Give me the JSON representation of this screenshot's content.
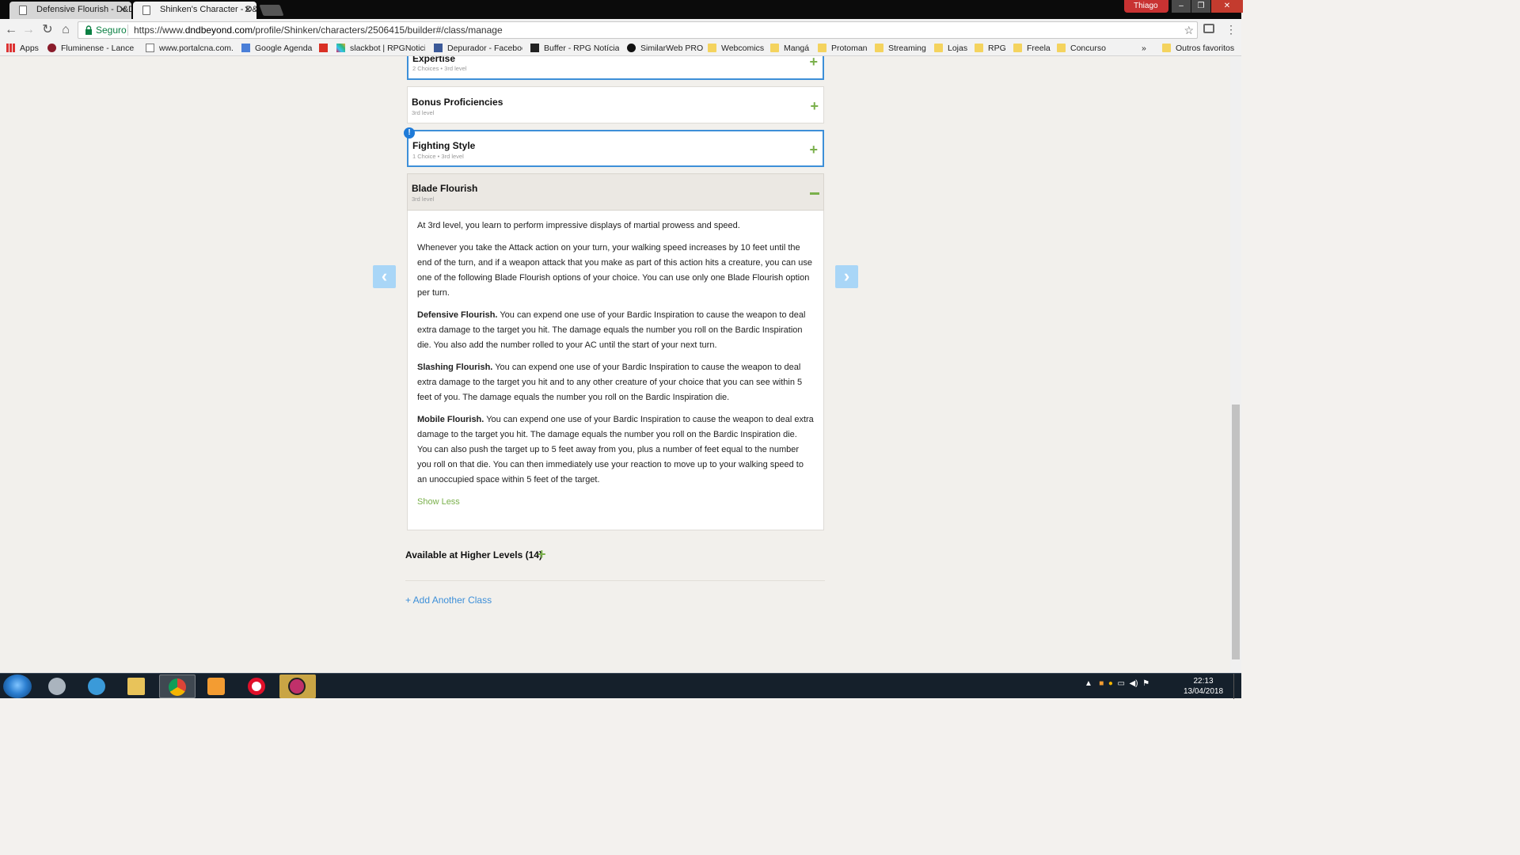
{
  "browser": {
    "tabs": [
      {
        "title": "Defensive Flourish - D&D"
      },
      {
        "title": "Shinken's Character - D&"
      }
    ],
    "profile_name": "Thiago",
    "security_label": "Seguro",
    "url_prefix": "https://www.",
    "url_domain": "dndbeyond.com",
    "url_path": "/profile/Shinken/characters/2506415/builder#/class/manage",
    "bookmarks": [
      {
        "label": "Apps"
      },
      {
        "label": "Fluminense - Lancenet"
      },
      {
        "label": "www.portalcna.com.br"
      },
      {
        "label": "Google Agenda"
      },
      {
        "label": "slackbot | RPGNoticias"
      },
      {
        "label": "Depurador - Facebook"
      },
      {
        "label": "Buffer - RPG Notícias"
      },
      {
        "label": "SimilarWeb PRO"
      },
      {
        "label": "Webcomics"
      },
      {
        "label": "Mangá"
      },
      {
        "label": "Protoman"
      },
      {
        "label": "Streaming"
      },
      {
        "label": "Lojas"
      },
      {
        "label": "RPG"
      },
      {
        "label": "Freela"
      },
      {
        "label": "Concurso"
      }
    ],
    "bookmarks_overflow": "»",
    "other_bookmarks": "Outros favoritos"
  },
  "features": [
    {
      "title": "Expertise",
      "subtitle": "2 Choices • 3rd level"
    },
    {
      "title": "Bonus Proficiencies",
      "subtitle": "3rd level"
    },
    {
      "title": "Fighting Style",
      "subtitle": "1 Choice • 3rd level"
    }
  ],
  "blade_flourish": {
    "title": "Blade Flourish",
    "subtitle": "3rd level",
    "intro": "At 3rd level, you learn to perform impressive displays of martial prowess and speed.",
    "paragraph": "Whenever you take the Attack action on your turn, your walking speed increases by 10 feet until the end of the turn, and if a weapon attack that you make as part of this action hits a creature, you can use one of the following Blade Flourish options of your choice. You can use only one Blade Flourish option per turn.",
    "options": [
      {
        "name": "Defensive Flourish.",
        "text": " You can expend one use of your Bardic Inspiration to cause the weapon to deal extra damage to the target you hit. The damage equals the number you roll on the Bardic Inspiration die. You also add the number rolled to your AC until the start of your next turn."
      },
      {
        "name": "Slashing Flourish.",
        "text": " You can expend one use of your Bardic Inspiration to cause the weapon to deal extra damage to the target you hit and to any other creature of your choice that you can see within 5 feet of you. The damage equals the number you roll on the Bardic Inspiration die."
      },
      {
        "name": "Mobile Flourish.",
        "text": " You can expend one use of your Bardic Inspiration to cause the weapon to deal extra damage to the target you hit. The damage equals the number you roll on the Bardic Inspiration die. You can also push the target up to 5 feet away from you, plus a number of feet equal to the number you roll on that die. You can then immediately use your reaction to move up to your walking speed to an unoccupied space within 5 feet of the target."
      }
    ],
    "show_less": "Show Less"
  },
  "higher_levels": "Available at Higher Levels (14)",
  "add_class": "+ Add Another Class",
  "taskbar": {
    "time": "22:13",
    "date": "13/04/2018"
  },
  "colors": {
    "accent_green": "#7ab04b",
    "accent_blue": "#3d8fd8",
    "page_bg": "#f2f0ec"
  }
}
